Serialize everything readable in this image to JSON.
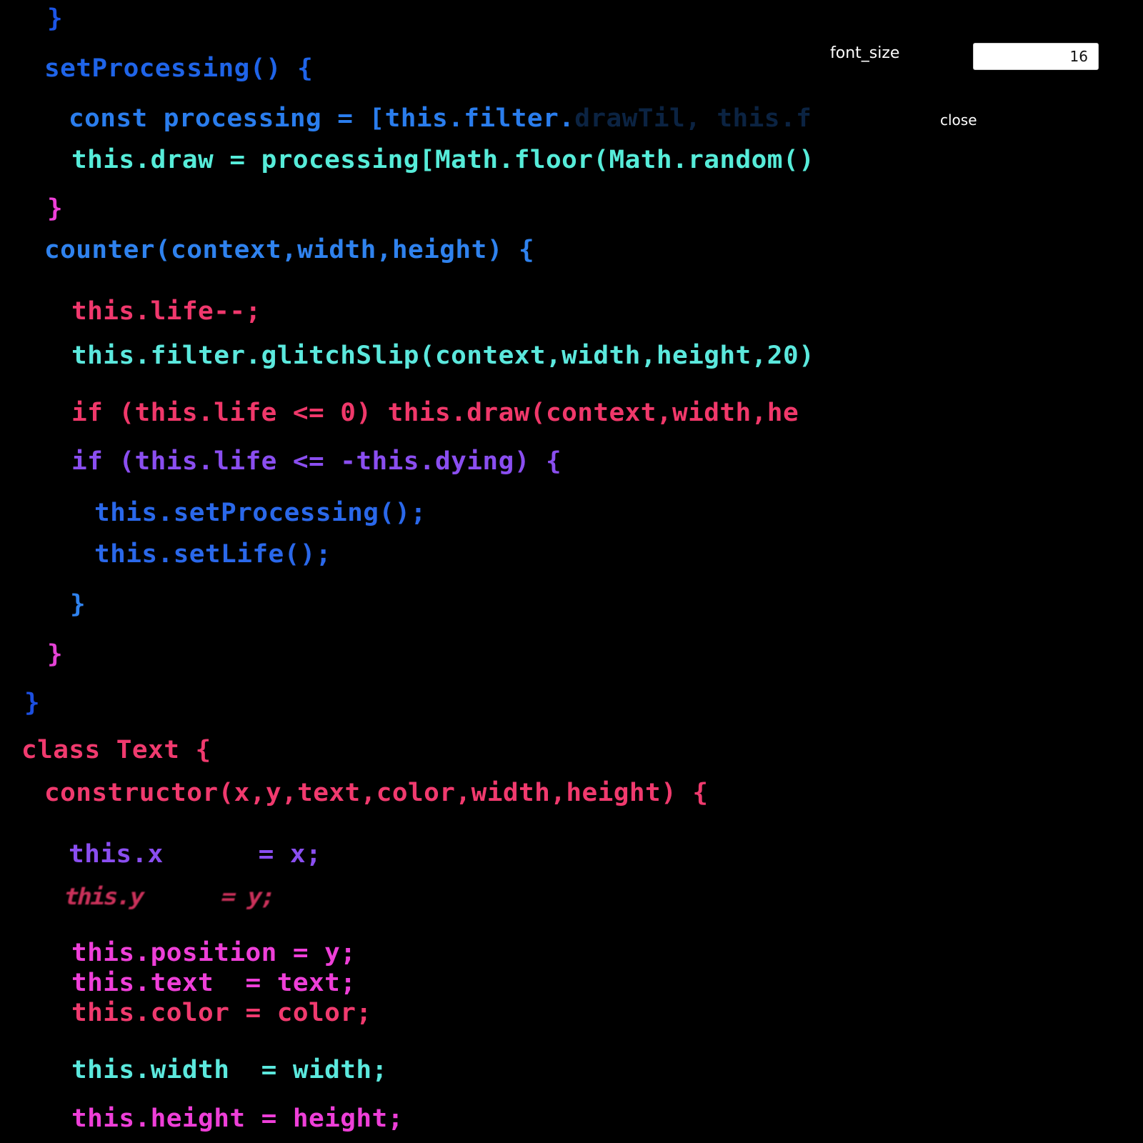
{
  "controls": {
    "font_size_label": "font_size",
    "font_size_value": "16",
    "close_label": "close"
  },
  "code_lines": [
    {
      "id": "close-brace-1",
      "text": "}",
      "color": "#1c55e6"
    },
    {
      "id": "set-processing-decl",
      "text": "setProcessing() {",
      "color": "#1f64e8"
    },
    {
      "id": "const-processing",
      "text": "const processing = [this.filter.",
      "faded": "drawTil, this.f",
      "color": "#2a7ded"
    },
    {
      "id": "this-draw-assign",
      "text": "this.draw = processing[Math.floor(Math.random()",
      "color": "#56ecd9"
    },
    {
      "id": "close-brace-2",
      "text": "}",
      "color": "#ee3fd8"
    },
    {
      "id": "counter-decl",
      "text": "counter(context,width,height) {",
      "color": "#2f82ee"
    },
    {
      "id": "life-decrement",
      "text": "this.life--;",
      "color": "#f0386d"
    },
    {
      "id": "glitch-slip-call",
      "text": "this.filter.glitchSlip(context,width,height,20)",
      "color": "#5be8dd"
    },
    {
      "id": "if-life-zero",
      "text": "if (this.life <= 0) this.draw(context,width,he",
      "color": "#f0386a"
    },
    {
      "id": "if-life-dying",
      "text": "if (this.life <= -this.dying) {",
      "color": "#8a4ef0"
    },
    {
      "id": "set-processing-call",
      "text": "this.setProcessing();",
      "color": "#2a68ea"
    },
    {
      "id": "set-life-call",
      "text": "this.setLife();",
      "color": "#2a68ea"
    },
    {
      "id": "close-brace-3",
      "text": "}",
      "color": "#2f82ee"
    },
    {
      "id": "close-brace-4",
      "text": "}",
      "color": "#e542d6"
    },
    {
      "id": "close-brace-5",
      "text": "}",
      "color": "#1c4fe0"
    },
    {
      "id": "class-text-decl",
      "text": "class Text {",
      "color": "#f03a6e"
    },
    {
      "id": "constructor-decl",
      "text": "constructor(x,y,text,color,width,height) {",
      "color": "#f03a6e"
    },
    {
      "id": "this-x-assign",
      "text": "this.x      = x;",
      "color": "#8a4ef0"
    },
    {
      "id": "this-y-assign",
      "text": "this.y      = y;",
      "color": "#ee3a6a"
    },
    {
      "id": "this-position-assign",
      "text": "this.position = y;",
      "color": "#ee3fd8"
    },
    {
      "id": "this-text-assign",
      "text": "this.text  = text;",
      "color": "#ee3fd8"
    },
    {
      "id": "this-color-assign",
      "text": "this.color = color;",
      "color": "#f03a6e"
    },
    {
      "id": "this-width-assign",
      "text": "this.width  = width;",
      "color": "#5be8dd"
    },
    {
      "id": "this-height-assign",
      "text": "this.height = height;",
      "color": "#ee3fd8"
    }
  ]
}
